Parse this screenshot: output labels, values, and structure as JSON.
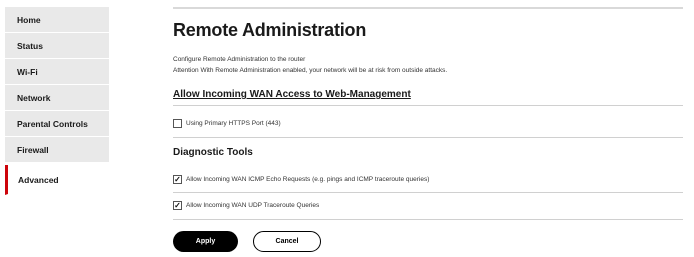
{
  "sidebar": {
    "items": [
      {
        "label": "Home"
      },
      {
        "label": "Status"
      },
      {
        "label": "Wi-Fi"
      },
      {
        "label": "Network"
      },
      {
        "label": "Parental Controls"
      },
      {
        "label": "Firewall"
      },
      {
        "label": "Advanced",
        "active": true
      }
    ],
    "active_color": "#cd040b"
  },
  "main": {
    "title": "Remote Administration",
    "description": "Configure Remote Administration to the router",
    "attention": "Attention With Remote Administration enabled, your network will be at risk from outside attacks.",
    "wan_section": {
      "heading": "Allow Incoming WAN Access to Web-Management",
      "https_option": {
        "label": "Using Primary HTTPS Port (443)",
        "checked": false
      }
    },
    "diagnostic_section": {
      "heading": "Diagnostic Tools",
      "icmp_option": {
        "label": "Allow Incoming WAN ICMP Echo Requests (e.g. pings and ICMP traceroute queries)",
        "checked": true
      },
      "udp_option": {
        "label": "Allow Incoming WAN UDP Traceroute Queries",
        "checked": true
      }
    },
    "buttons": {
      "apply": "Apply",
      "cancel": "Cancel"
    }
  }
}
